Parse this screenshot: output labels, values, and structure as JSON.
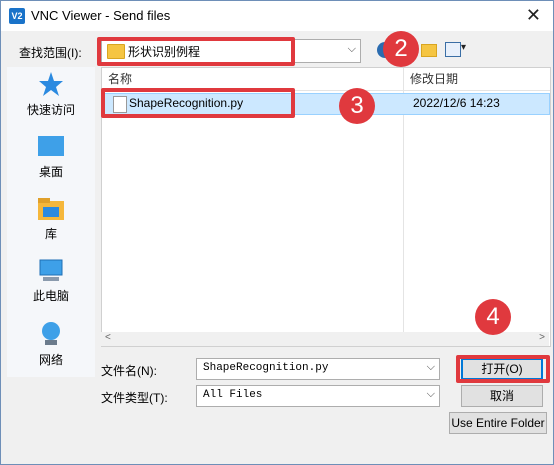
{
  "window": {
    "title": "VNC Viewer - Send files",
    "app_icon": "V2",
    "close": "✕"
  },
  "lookin": {
    "label": "查找范围(I):",
    "value": "形状识别例程"
  },
  "places": [
    {
      "label": "快速访问",
      "icon": "star-icon"
    },
    {
      "label": "桌面",
      "icon": "desktop-icon"
    },
    {
      "label": "库",
      "icon": "library-icon"
    },
    {
      "label": "此电脑",
      "icon": "computer-icon"
    },
    {
      "label": "网络",
      "icon": "network-icon"
    }
  ],
  "filelist": {
    "columns": [
      "名称",
      "修改日期"
    ],
    "rows": [
      {
        "name": "ShapeRecognition.py",
        "date": "2022/12/6 14:23"
      }
    ]
  },
  "filename": {
    "label": "文件名(N):",
    "value": "ShapeRecognition.py"
  },
  "filetype": {
    "label": "文件类型(T):",
    "value": "All Files"
  },
  "buttons": {
    "open": "打开(O)",
    "cancel": "取消",
    "use_folder": "Use Entire Folder"
  },
  "badges": [
    "2",
    "3",
    "4"
  ],
  "colors": {
    "highlight": "#e0393e",
    "selection": "#cce8ff"
  }
}
